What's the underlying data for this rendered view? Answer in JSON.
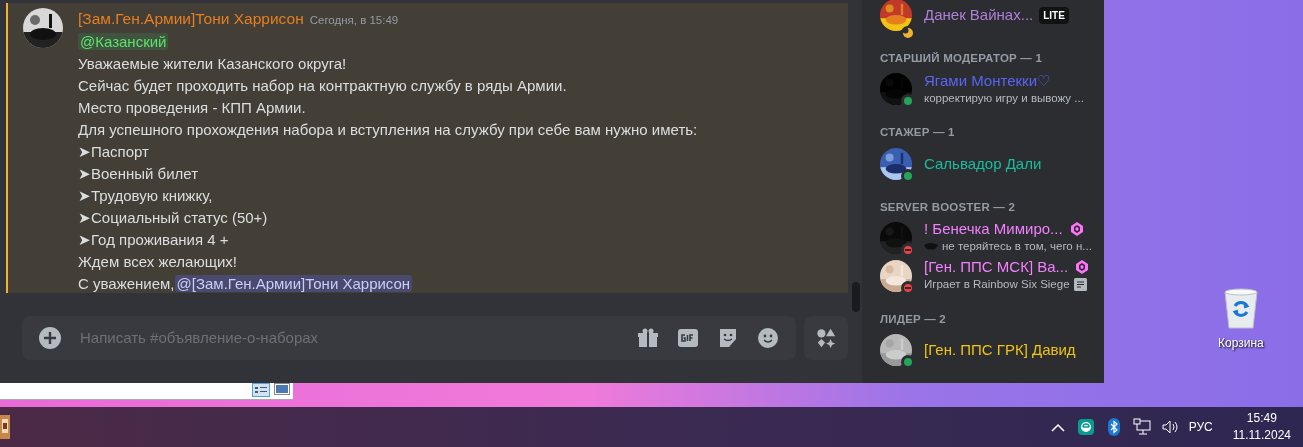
{
  "message": {
    "author": "[Зам.Ген.Армии]Тони Харрисон",
    "timestamp": "Сегодня, в 15:49",
    "highlighted": true,
    "mention": "@Казанский",
    "lines": [
      "Уважаемые жители Казанского округа!",
      "Сейчас будет проходить набор на контрактную службу в ряды Армии.",
      "Место проведения -  КПП Армии.",
      "Для успешного прохождения набора и вступления на службу при себе вам нужно иметь:",
      "➤Паспорт",
      "➤Военный билет",
      "➤Трудовую книжку,",
      "➤Социальный статус (50+)",
      "➤Год проживания 4 +",
      "Ждем всех желающих!"
    ],
    "signature": {
      "text": "С уважением,",
      "mention": "@[Зам.Ген.Армии]Тони Харрисон"
    }
  },
  "composer": {
    "placeholder": "Написать #объявление-о-наборах"
  },
  "members": {
    "groups": [
      {
        "members": [
          {
            "name": "Данек Вайнах...",
            "color": "#b07fd8",
            "status": {
              "color": "#f0b232",
              "idle": true
            },
            "badge": "LITE"
          }
        ]
      },
      {
        "title": "СТАРШИЙ МОДЕРАТОР — 1",
        "members": [
          {
            "name": "Ягами Монтекки♡",
            "color": "#5865f2",
            "status": {
              "color": "#23a55a"
            },
            "activity": "корректирую игру и вывожу ..."
          }
        ]
      },
      {
        "title": "СТАЖЕР — 1",
        "members": [
          {
            "name": "Сальвадор Дали",
            "color": "#1abc9c",
            "status": {
              "color": "#23a55a"
            }
          }
        ]
      },
      {
        "title": "SERVER BOOSTER — 2",
        "members": [
          {
            "name": "! Бенечка Мимиро...",
            "color": "#f47fff",
            "status": {
              "color": "#f23f43",
              "dnd": true
            },
            "booster": true,
            "activity": "не теряйтесь в том, чего н...",
            "custom_emoji": true
          },
          {
            "name": "[Ген. ППС МСК] Ва...",
            "color": "#f47fff",
            "status": {
              "color": "#f23f43",
              "dnd": true
            },
            "booster": true,
            "activity": "Играет в Rainbow Six Siege",
            "details": true
          }
        ]
      },
      {
        "title": "ЛИДЕР — 2",
        "members": [
          {
            "name": "[Ген. ППС ГРК] Давид",
            "color": "#f1c40f",
            "status": {
              "color": "#23a55a"
            }
          }
        ]
      }
    ]
  },
  "desktop": {
    "icons": [
      {
        "label": "Корзина"
      }
    ]
  },
  "taskbar": {
    "language": "РУС",
    "time": "15:49",
    "date": "11.11.2024"
  }
}
